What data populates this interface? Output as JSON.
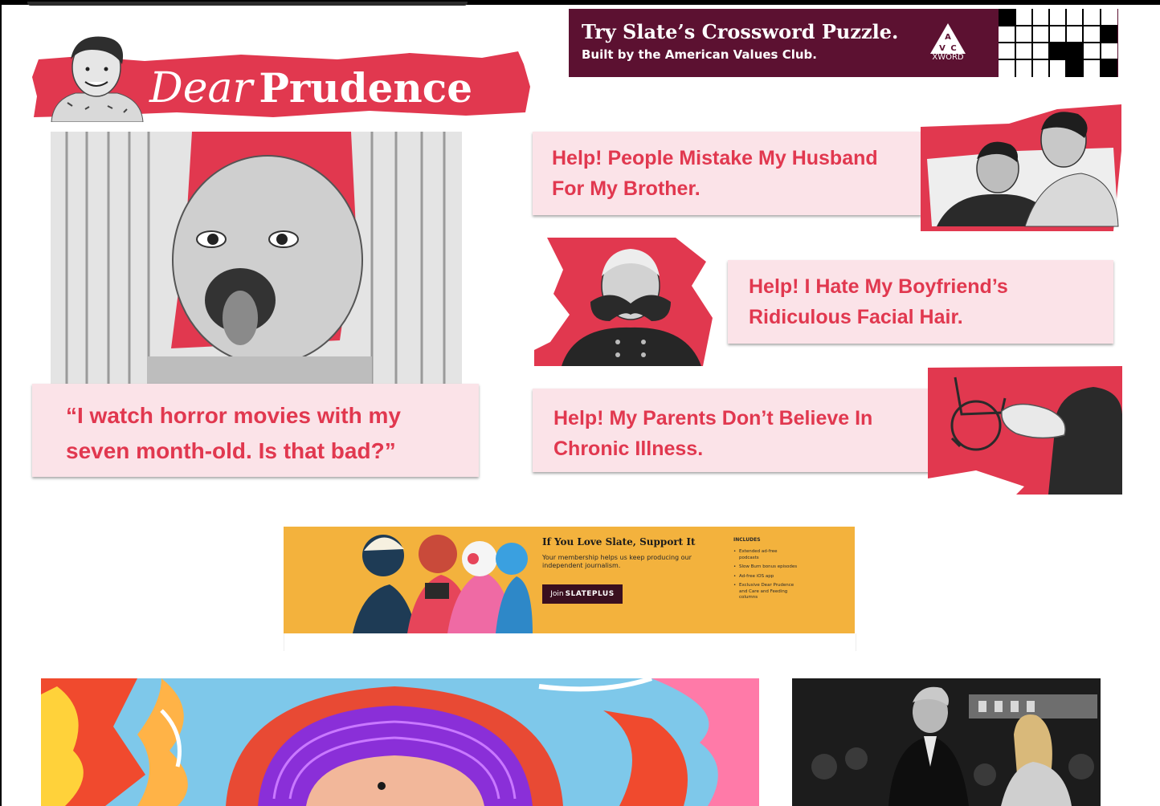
{
  "header": {
    "script_word": "Dear",
    "bold_word": "Prudence"
  },
  "crossword_ad": {
    "title": "Try Slate’s Crossword Puzzle.",
    "subtitle": "Built by the American Values Club.",
    "logo_letters": "A V C",
    "logo_label": "XWORD"
  },
  "featured": {
    "quote": "“I watch horror movies with my seven month-old. Is that bad?”"
  },
  "side_cards": [
    {
      "title": "Help! People Mistake My Husband For My Brother."
    },
    {
      "title": "Help! I Hate My Boyfriend’s Ridiculous Facial Hair."
    },
    {
      "title": "Help! My Parents Don’t Believe In Chronic Illness."
    }
  ],
  "plus_ad": {
    "title": "If You Love Slate, Support It",
    "body": "Your membership helps us keep producing our independent journalism.",
    "button_join": "Join",
    "button_brand": "SLATEPLUS",
    "includes_label": "INCLUDES",
    "includes": [
      "Extended ad-free podcasts",
      "Slow Burn bonus episodes",
      "Ad-free iOS app",
      "Exclusive Dear Prudence and Care and Feeding columns"
    ]
  },
  "colors": {
    "brand_red": "#e1384f",
    "card_bg": "#fbe3e8",
    "crossword_bg": "#5c1131",
    "plus_bg": "#f3b23d"
  }
}
